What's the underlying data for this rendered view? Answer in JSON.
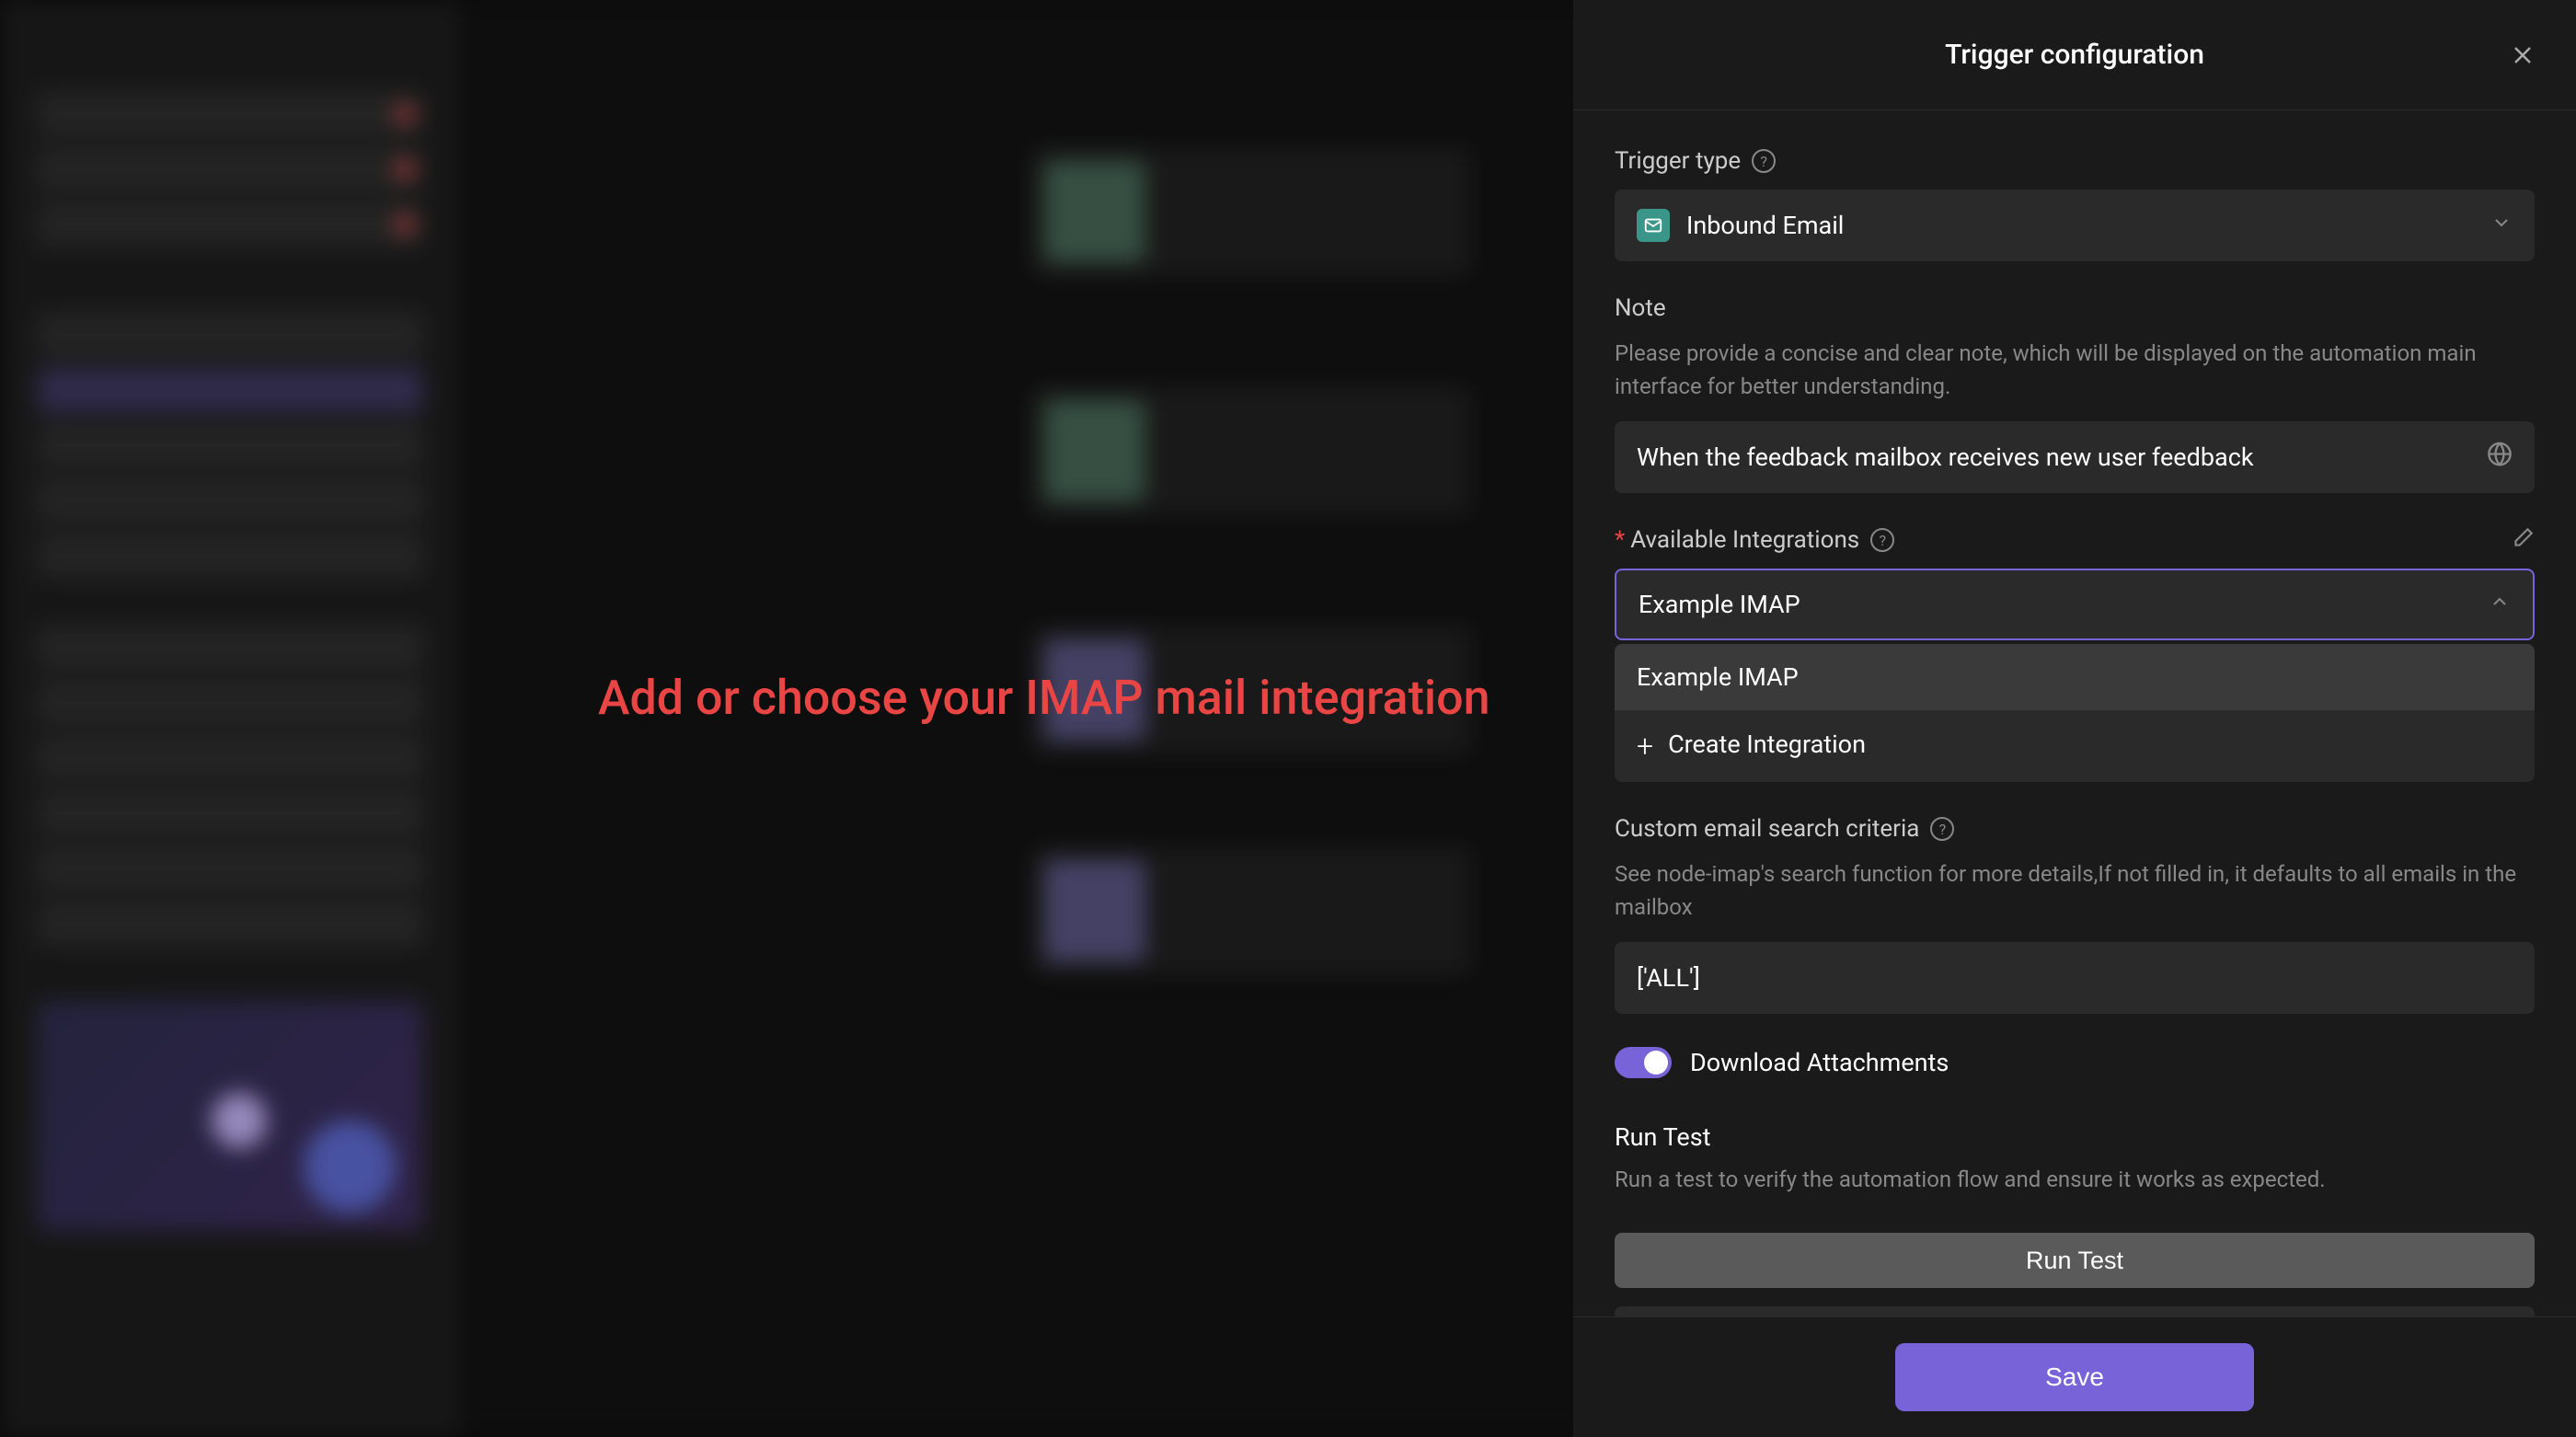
{
  "annotation": "Add or choose your IMAP mail integration",
  "panel": {
    "title": "Trigger configuration",
    "trigger_type": {
      "label": "Trigger type",
      "value": "Inbound Email"
    },
    "note": {
      "label": "Note",
      "description": "Please provide a concise and clear note, which will be displayed on the automation main interface for better understanding.",
      "value": "When the feedback mailbox receives new user feedback"
    },
    "integrations": {
      "label": "Available Integrations",
      "value": "Example IMAP",
      "options": [
        {
          "label": "Example IMAP"
        },
        {
          "label": "Create Integration",
          "is_create": true
        }
      ]
    },
    "search_criteria": {
      "label": "Custom email search criteria",
      "description": "See node-imap's search function for more details,If not filled in, it defaults to all emails in the mailbox",
      "value": "['ALL']"
    },
    "download_attachments": {
      "label": "Download Attachments",
      "enabled": true
    },
    "run_test": {
      "title": "Run Test",
      "description": "Run a test to verify the automation flow and ensure it works as expected.",
      "button": "Run Test"
    },
    "save_button": "Save"
  }
}
